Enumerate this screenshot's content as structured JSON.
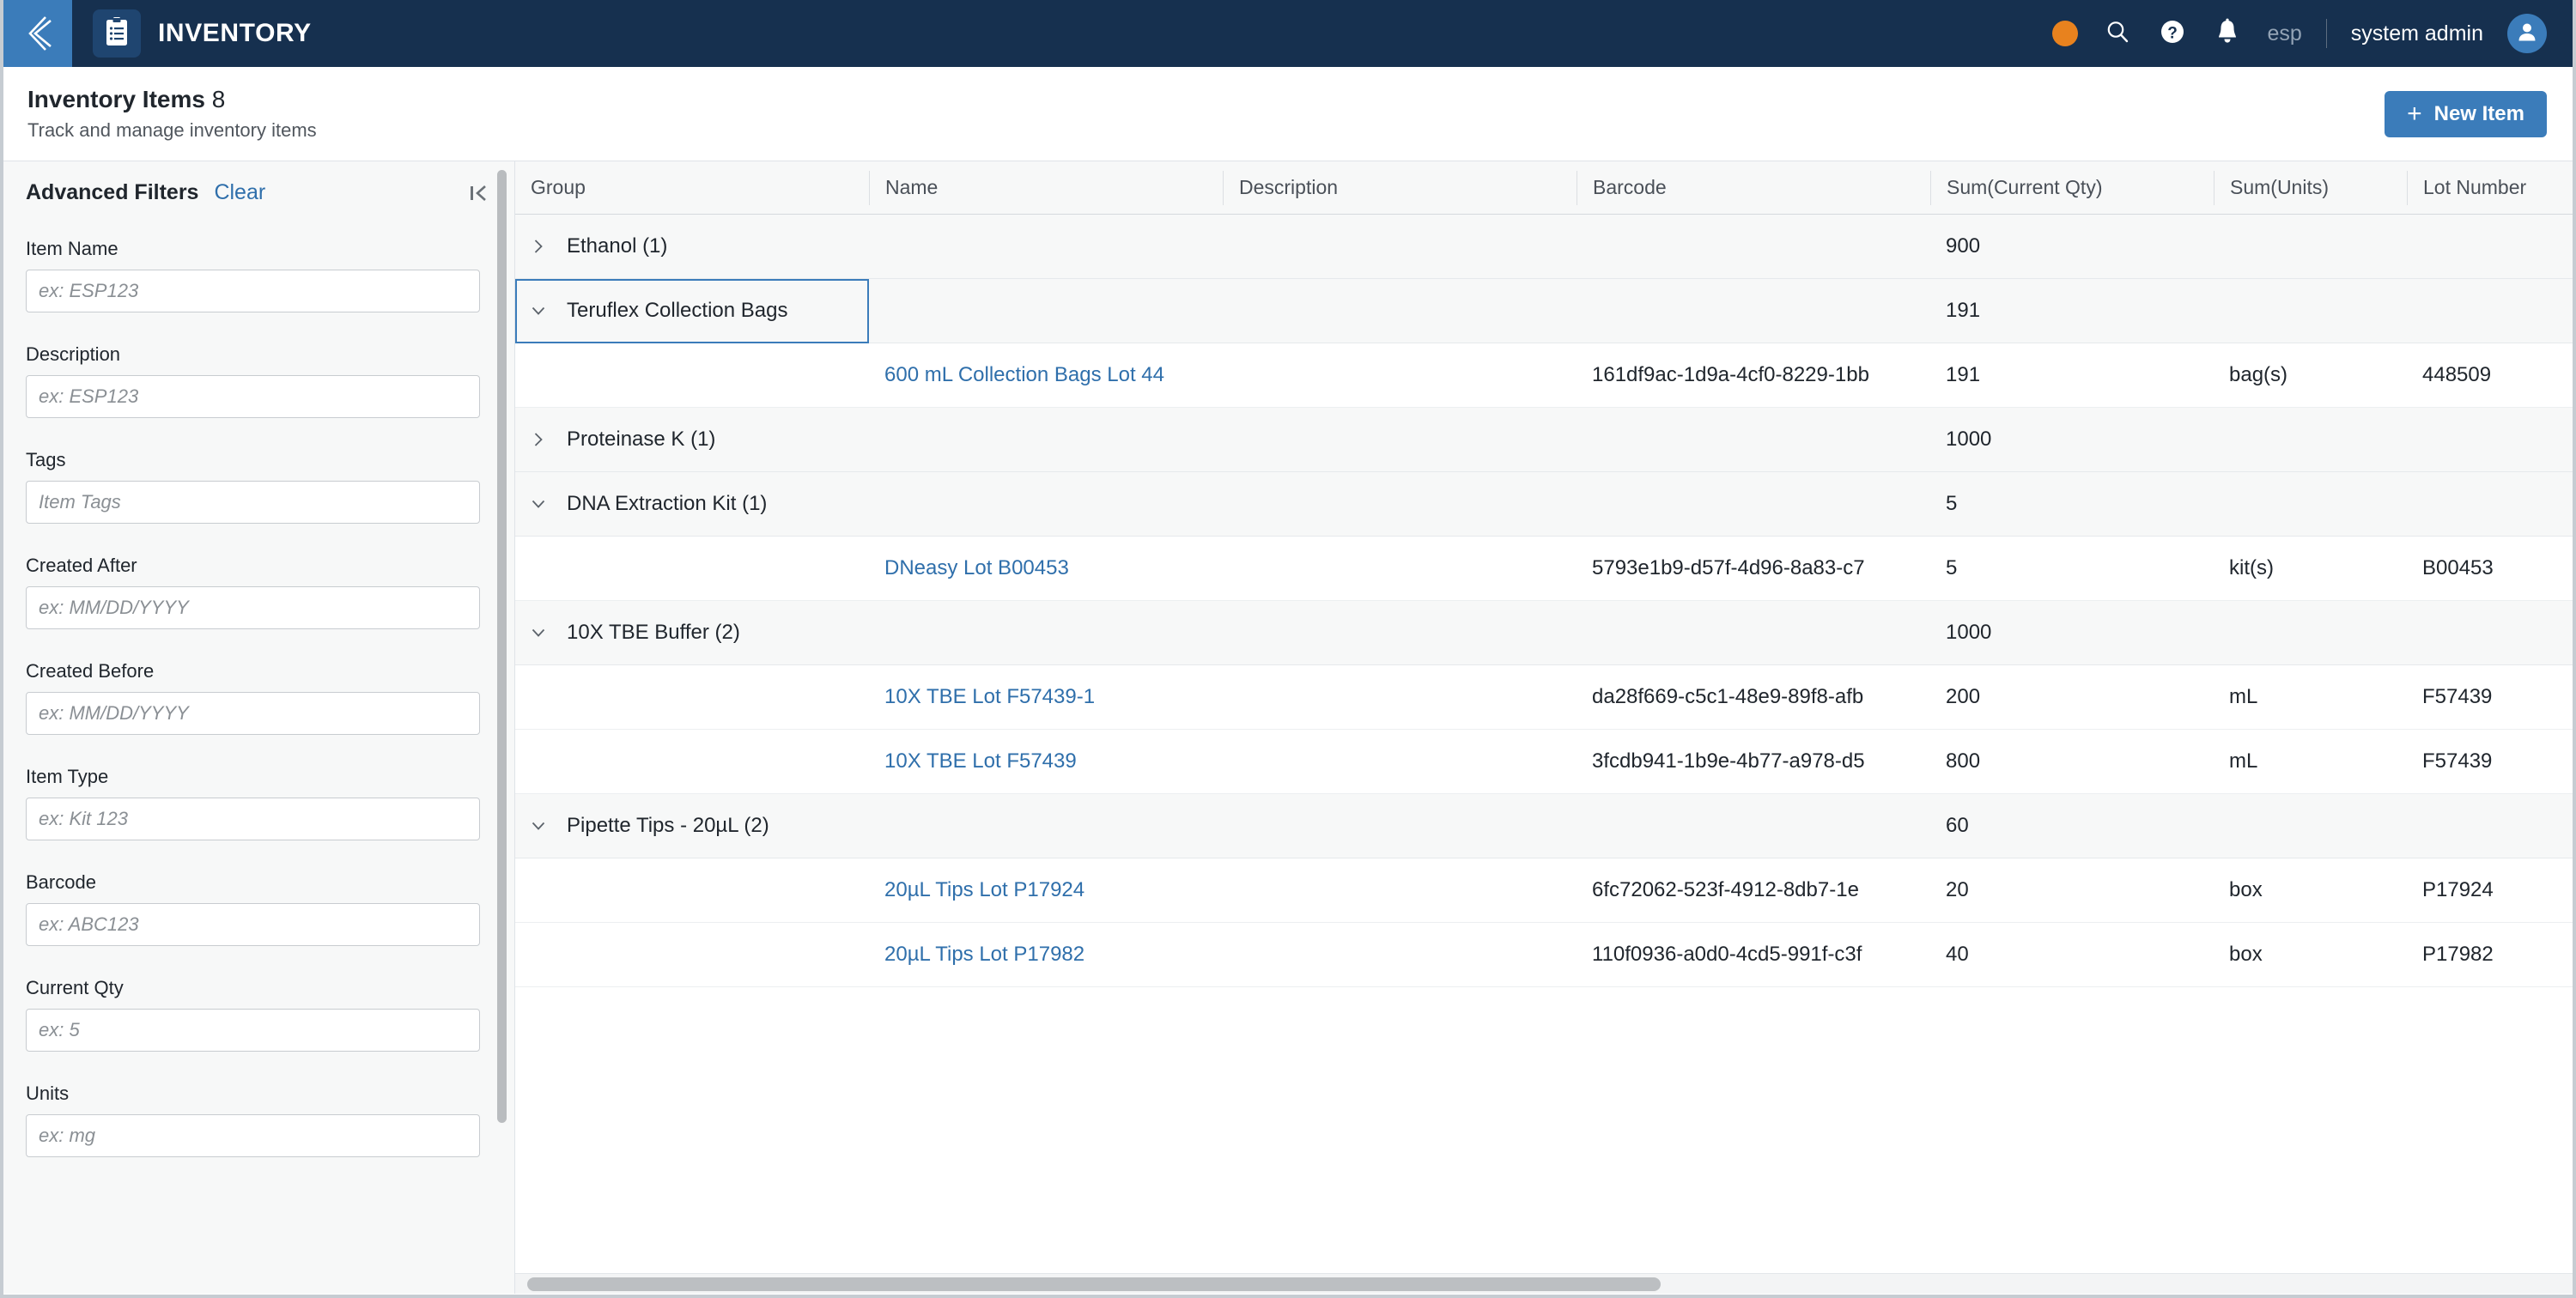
{
  "topbar": {
    "back_icon": "back-chevron-icon",
    "app_icon": "clipboard-icon",
    "app_title": "INVENTORY",
    "status_indicator": "status-dot",
    "search_icon": "search-icon",
    "help_icon": "help-icon",
    "notifications_icon": "bell-icon",
    "language": "esp",
    "username": "system admin",
    "avatar_icon": "user-avatar-icon"
  },
  "pagehead": {
    "title": "Inventory Items",
    "count": "8",
    "subtitle": "Track and manage inventory items",
    "new_item_label": "New Item",
    "new_item_plus": "+"
  },
  "filters": {
    "title": "Advanced Filters",
    "clear_label": "Clear",
    "collapse_icon": "collapse-panel-icon",
    "fields": [
      {
        "label": "Item Name",
        "placeholder": "ex: ESP123",
        "value": ""
      },
      {
        "label": "Description",
        "placeholder": "ex: ESP123",
        "value": ""
      },
      {
        "label": "Tags",
        "placeholder": "Item Tags",
        "value": ""
      },
      {
        "label": "Created After",
        "placeholder": "ex: MM/DD/YYYY",
        "value": ""
      },
      {
        "label": "Created Before",
        "placeholder": "ex: MM/DD/YYYY",
        "value": ""
      },
      {
        "label": "Item Type",
        "placeholder": "ex: Kit 123",
        "value": ""
      },
      {
        "label": "Barcode",
        "placeholder": "ex: ABC123",
        "value": ""
      },
      {
        "label": "Current Qty",
        "placeholder": "ex: 5",
        "value": ""
      },
      {
        "label": "Units",
        "placeholder": "ex: mg",
        "value": ""
      }
    ]
  },
  "table": {
    "columns": [
      "Group",
      "Name",
      "Description",
      "Barcode",
      "Sum(Current Qty)",
      "Sum(Units)",
      "Lot Number"
    ],
    "rows": [
      {
        "kind": "group",
        "expanded": false,
        "selected": false,
        "chevron": "chevron-right-icon",
        "group": "Ethanol (1)",
        "name": "",
        "description": "",
        "barcode": "",
        "sum_qty": "900",
        "sum_units": "",
        "lot": ""
      },
      {
        "kind": "group",
        "expanded": true,
        "selected": true,
        "chevron": "chevron-down-icon",
        "group": "Teruflex Collection Bags",
        "name": "",
        "description": "",
        "barcode": "",
        "sum_qty": "191",
        "sum_units": "",
        "lot": ""
      },
      {
        "kind": "item",
        "chevron": "",
        "group": "",
        "name": "600 mL Collection Bags Lot 44",
        "description": "",
        "barcode": "161df9ac-1d9a-4cf0-8229-1bb",
        "sum_qty": "191",
        "sum_units": "bag(s)",
        "lot": "448509"
      },
      {
        "kind": "group",
        "expanded": false,
        "selected": false,
        "chevron": "chevron-right-icon",
        "group": "Proteinase K (1)",
        "name": "",
        "description": "",
        "barcode": "",
        "sum_qty": "1000",
        "sum_units": "",
        "lot": ""
      },
      {
        "kind": "group",
        "expanded": true,
        "selected": false,
        "chevron": "chevron-down-icon",
        "group": "DNA Extraction Kit (1)",
        "name": "",
        "description": "",
        "barcode": "",
        "sum_qty": "5",
        "sum_units": "",
        "lot": ""
      },
      {
        "kind": "item",
        "chevron": "",
        "group": "",
        "name": "DNeasy Lot B00453",
        "description": "",
        "barcode": "5793e1b9-d57f-4d96-8a83-c7",
        "sum_qty": "5",
        "sum_units": "kit(s)",
        "lot": "B00453"
      },
      {
        "kind": "group",
        "expanded": true,
        "selected": false,
        "chevron": "chevron-down-icon",
        "group": "10X TBE Buffer (2)",
        "name": "",
        "description": "",
        "barcode": "",
        "sum_qty": "1000",
        "sum_units": "",
        "lot": ""
      },
      {
        "kind": "item",
        "chevron": "",
        "group": "",
        "name": "10X TBE Lot F57439-1",
        "description": "",
        "barcode": "da28f669-c5c1-48e9-89f8-afb",
        "sum_qty": "200",
        "sum_units": "mL",
        "lot": "F57439"
      },
      {
        "kind": "item",
        "chevron": "",
        "group": "",
        "name": "10X TBE Lot F57439",
        "description": "",
        "barcode": "3fcdb941-1b9e-4b77-a978-d5",
        "sum_qty": "800",
        "sum_units": "mL",
        "lot": "F57439"
      },
      {
        "kind": "group",
        "expanded": true,
        "selected": false,
        "chevron": "chevron-down-icon",
        "group": "Pipette Tips - 20µL (2)",
        "name": "",
        "description": "",
        "barcode": "",
        "sum_qty": "60",
        "sum_units": "",
        "lot": ""
      },
      {
        "kind": "item",
        "chevron": "",
        "group": "",
        "name": "20µL Tips Lot P17924",
        "description": "",
        "barcode": "6fc72062-523f-4912-8db7-1e",
        "sum_qty": "20",
        "sum_units": "box",
        "lot": "P17924"
      },
      {
        "kind": "item",
        "chevron": "",
        "group": "",
        "name": "20µL Tips Lot P17982",
        "description": "",
        "barcode": "110f0936-a0d0-4cd5-991f-c3f",
        "sum_qty": "40",
        "sum_units": "box",
        "lot": "P17982"
      }
    ]
  },
  "colors": {
    "topbar_bg": "#16304f",
    "accent_blue": "#3b7cba",
    "link_blue": "#2f6fab",
    "status_orange": "#e8821e",
    "panel_bg": "#f7f8f8"
  }
}
